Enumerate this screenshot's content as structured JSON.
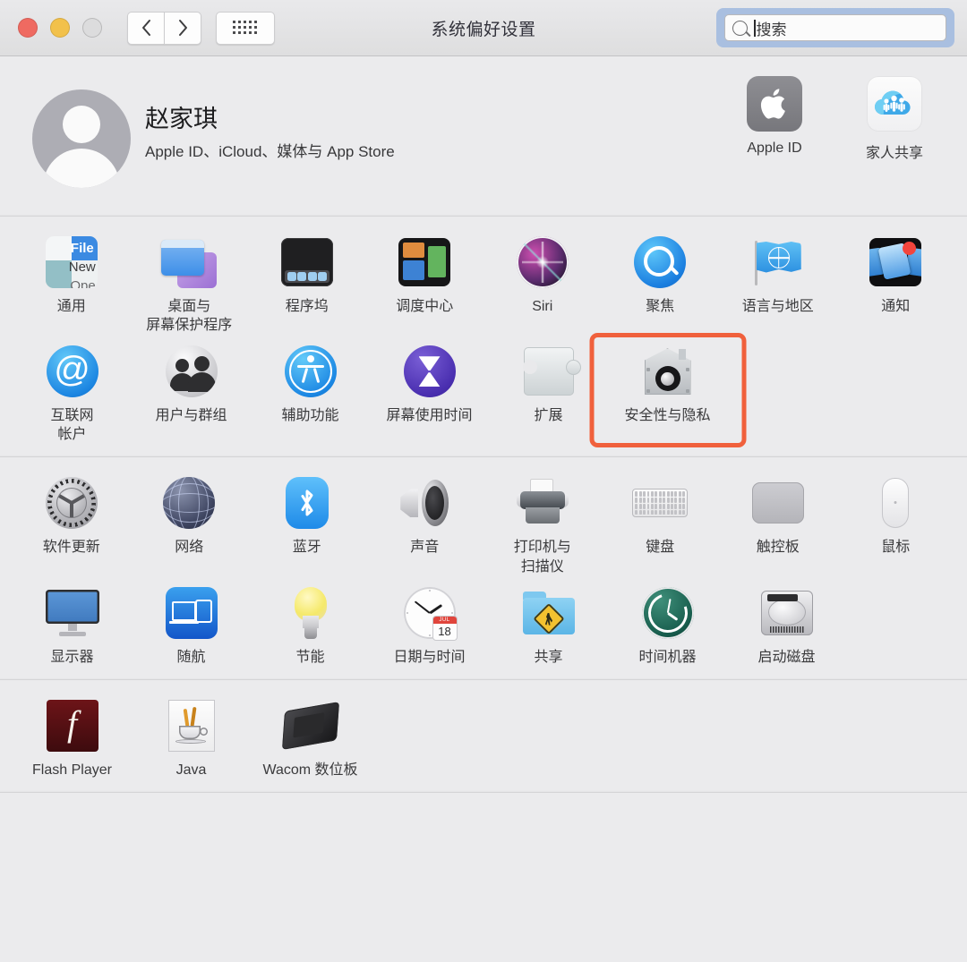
{
  "window": {
    "title": "系统偏好设置",
    "traffic_lights": [
      "close",
      "minimize",
      "zoom"
    ],
    "nav": {
      "back_label": "‹",
      "forward_label": "›"
    },
    "grid_button_name": "show-all"
  },
  "search": {
    "placeholder": "搜索",
    "value": "",
    "focused": true
  },
  "account": {
    "name": "赵家琪",
    "subtitle": "Apple ID、iCloud、媒体与 App Store",
    "items": [
      {
        "label": "Apple ID",
        "icon": "apple-logo-icon"
      },
      {
        "label": "家人共享",
        "icon": "family-sharing-icon"
      }
    ]
  },
  "accent_color": "#f0603c",
  "selected_item": "安全性与隐私",
  "sections": [
    {
      "id": "personal",
      "rows": [
        [
          {
            "label": "通用",
            "icon": "general-icon"
          },
          {
            "label": "桌面与\n屏幕保护程序",
            "icon": "desktop-screensaver-icon"
          },
          {
            "label": "程序坞",
            "icon": "dock-icon"
          },
          {
            "label": "调度中心",
            "icon": "mission-control-icon"
          },
          {
            "label": "Siri",
            "icon": "siri-icon"
          },
          {
            "label": "聚焦",
            "icon": "spotlight-icon"
          },
          {
            "label": "语言与地区",
            "icon": "language-region-icon"
          },
          {
            "label": "通知",
            "icon": "notifications-icon"
          }
        ],
        [
          {
            "label": "互联网\n帐户",
            "icon": "internet-accounts-icon"
          },
          {
            "label": "用户与群组",
            "icon": "users-groups-icon"
          },
          {
            "label": "辅助功能",
            "icon": "accessibility-icon"
          },
          {
            "label": "屏幕使用时间",
            "icon": "screen-time-icon"
          },
          {
            "label": "扩展",
            "icon": "extensions-icon"
          },
          {
            "label": "安全性与隐私",
            "icon": "security-privacy-icon"
          }
        ]
      ]
    },
    {
      "id": "hardware",
      "rows": [
        [
          {
            "label": "软件更新",
            "icon": "software-update-icon"
          },
          {
            "label": "网络",
            "icon": "network-icon"
          },
          {
            "label": "蓝牙",
            "icon": "bluetooth-icon"
          },
          {
            "label": "声音",
            "icon": "sound-icon"
          },
          {
            "label": "打印机与\n扫描仪",
            "icon": "printers-scanners-icon"
          },
          {
            "label": "键盘",
            "icon": "keyboard-icon"
          },
          {
            "label": "触控板",
            "icon": "trackpad-icon"
          },
          {
            "label": "鼠标",
            "icon": "mouse-icon"
          }
        ],
        [
          {
            "label": "显示器",
            "icon": "displays-icon"
          },
          {
            "label": "随航",
            "icon": "sidecar-icon"
          },
          {
            "label": "节能",
            "icon": "energy-saver-icon"
          },
          {
            "label": "日期与时间",
            "icon": "date-time-icon"
          },
          {
            "label": "共享",
            "icon": "sharing-icon"
          },
          {
            "label": "时间机器",
            "icon": "time-machine-icon"
          },
          {
            "label": "启动磁盘",
            "icon": "startup-disk-icon"
          }
        ]
      ]
    },
    {
      "id": "third-party",
      "rows": [
        [
          {
            "label": "Flash Player",
            "icon": "flash-player-icon"
          },
          {
            "label": "Java",
            "icon": "java-icon"
          },
          {
            "label": "Wacom 数位板",
            "icon": "wacom-tablet-icon"
          }
        ]
      ]
    }
  ],
  "clock_icon": {
    "month": "JUL",
    "day": "18"
  },
  "general_icon_text": {
    "line1": "File",
    "line2": "New",
    "line3": "Ope"
  },
  "flash_icon_glyph": "f",
  "at_glyph": "@"
}
